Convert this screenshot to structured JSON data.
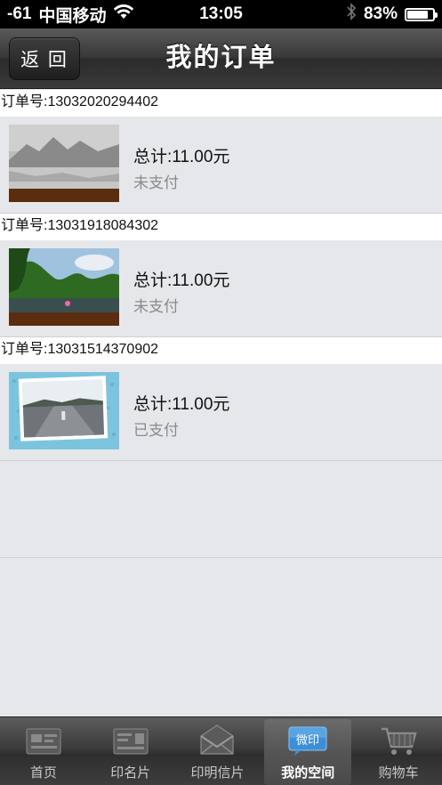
{
  "status_bar": {
    "signal": "-61",
    "carrier": "中国移动",
    "time": "13:05",
    "battery": "83%",
    "battery_level": 0.83,
    "icons": [
      "wifi-icon",
      "bluetooth-icon",
      "battery-icon"
    ]
  },
  "nav": {
    "back_label": "返 回",
    "title": "我的订单"
  },
  "orders": [
    {
      "number": "订单号:13032020294402",
      "total": "总计:11.00元",
      "status": "未支付",
      "thumbnail": "mountain-lake-photo"
    },
    {
      "number": "订单号:13031918084302",
      "total": "总计:11.00元",
      "status": "未支付",
      "thumbnail": "forest-river-photo"
    },
    {
      "number": "订单号:13031514370902",
      "total": "总计:11.00元",
      "status": "已支付",
      "thumbnail": "rainy-road-postcard"
    }
  ],
  "tabs": [
    {
      "label": "首页",
      "icon": "home-card-icon",
      "active": false
    },
    {
      "label": "印名片",
      "icon": "business-card-icon",
      "active": false
    },
    {
      "label": "印明信片",
      "icon": "envelope-icon",
      "active": false
    },
    {
      "label": "我的空间",
      "icon": "weiyin-badge-icon",
      "badge_text": "微印",
      "active": true
    },
    {
      "label": "购物车",
      "icon": "shopping-cart-icon",
      "active": false
    }
  ],
  "colors": {
    "background": "#e6e7ea",
    "status_unpaid": "#8a8a8a",
    "active_badge": "#3c8fd6"
  }
}
